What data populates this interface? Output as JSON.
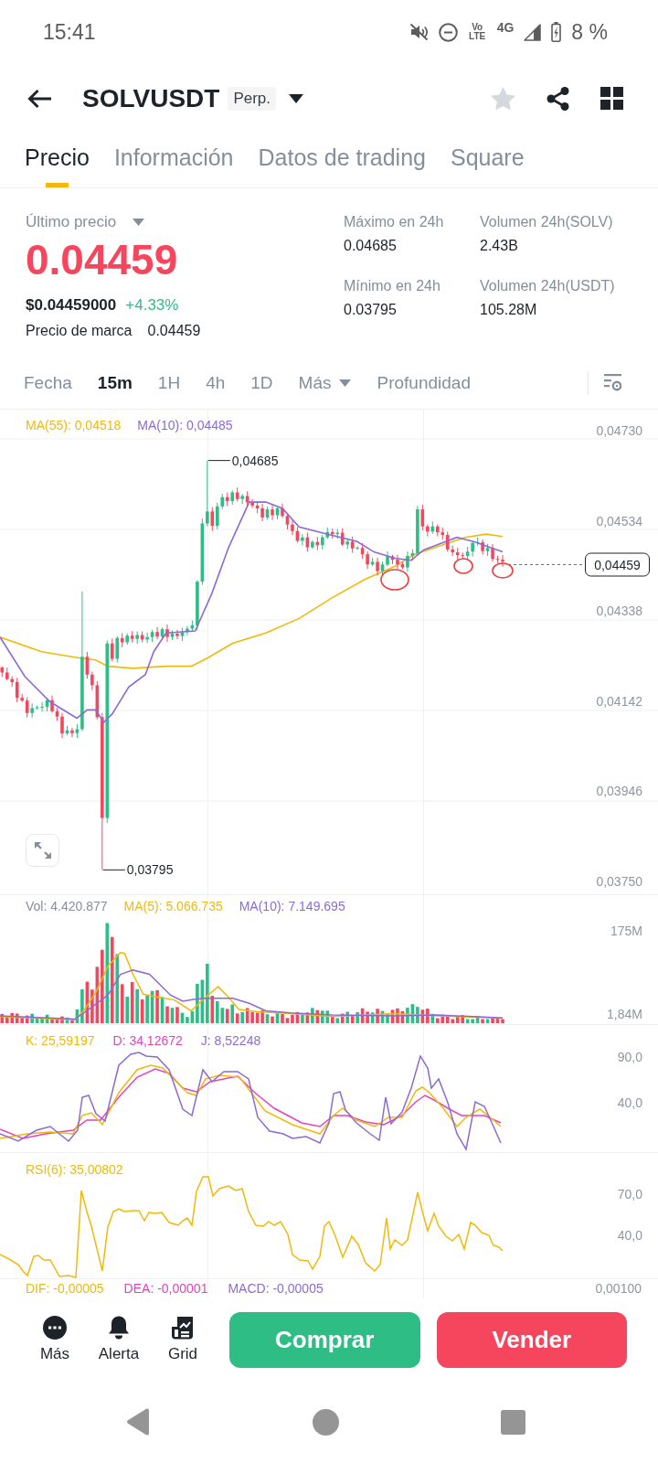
{
  "status_bar": {
    "time": "15:41",
    "volte": "Vo LTE",
    "network": "4G",
    "battery": "8 %"
  },
  "header": {
    "symbol": "SOLVUSDT",
    "badge": "Perp.",
    "favorite": false
  },
  "tabs": [
    {
      "label": "Precio",
      "selected": true
    },
    {
      "label": "Información",
      "selected": false
    },
    {
      "label": "Datos de trading",
      "selected": false
    },
    {
      "label": "Square",
      "selected": false
    }
  ],
  "ticker": {
    "last_price_label": "Último precio",
    "last_price": "0.04459",
    "last_price_falling": true,
    "usd_price": "$0.04459000",
    "change": "+4.33%",
    "change_positive": true,
    "mark_price_label": "Precio de marca",
    "mark_price": "0.04459",
    "stats": [
      {
        "label": "Máximo en 24h",
        "value": "0.04685"
      },
      {
        "label": "Volumen 24h(SOLV)",
        "value": "2.43B"
      },
      {
        "label": "Mínimo en 24h",
        "value": "0.03795"
      },
      {
        "label": "Volumen 24h(USDT)",
        "value": "105.28M"
      }
    ]
  },
  "intervals": [
    {
      "label": "Fecha",
      "kind": "option",
      "selected": false
    },
    {
      "label": "15m",
      "kind": "option",
      "selected": true
    },
    {
      "label": "1H",
      "kind": "option",
      "selected": false
    },
    {
      "label": "4h",
      "kind": "option",
      "selected": false
    },
    {
      "label": "1D",
      "kind": "option",
      "selected": false
    },
    {
      "label": "Más",
      "kind": "menu",
      "selected": false
    },
    {
      "label": "Profundidad",
      "kind": "option",
      "selected": false
    }
  ],
  "chart": {
    "legend": [
      {
        "label": "MA(55): 0,04518",
        "color": "#f0b90b"
      },
      {
        "label": "MA(10): 0,04485",
        "color": "#8c6ad6"
      }
    ],
    "price_axis": [
      "0,04730",
      "0,04534",
      "0,04338",
      "0,04142",
      "0,03946",
      "0,03750"
    ],
    "high_label": "0,04685",
    "low_label": "0,03795",
    "current_price": "0,04459"
  },
  "volume": {
    "legend": [
      {
        "label": "Vol: 4.420.877",
        "color": "#848e9c"
      },
      {
        "label": "MA(5): 5.066.735",
        "color": "#f0b90b"
      },
      {
        "label": "MA(10): 7.149.695",
        "color": "#8c6ad6"
      }
    ],
    "axis": [
      "175M",
      "1,84M"
    ]
  },
  "kdj": {
    "legend": [
      {
        "label": "K: 25,59197",
        "color": "#f0b90b"
      },
      {
        "label": "D: 34,12672",
        "color": "#e542bd"
      },
      {
        "label": "J: 8,52248",
        "color": "#8c6ad6"
      }
    ],
    "axis": [
      "90,0",
      "40,0"
    ]
  },
  "rsi": {
    "legend": [
      {
        "label": "RSI(6): 35,00802",
        "color": "#f0b90b"
      }
    ],
    "axis": [
      "70,0",
      "40,0"
    ]
  },
  "macd": {
    "legend": [
      {
        "label": "DIF: -0,00005",
        "color": "#f0b90b"
      },
      {
        "label": "DEA: -0,00001",
        "color": "#e542bd"
      },
      {
        "label": "MACD: -0,00005",
        "color": "#8c6ad6"
      }
    ],
    "axis": [
      "0,00100"
    ]
  },
  "bottom_bar": {
    "tools": [
      "Más",
      "Alerta",
      "Grid"
    ],
    "buy": "Comprar",
    "sell": "Vender"
  }
}
